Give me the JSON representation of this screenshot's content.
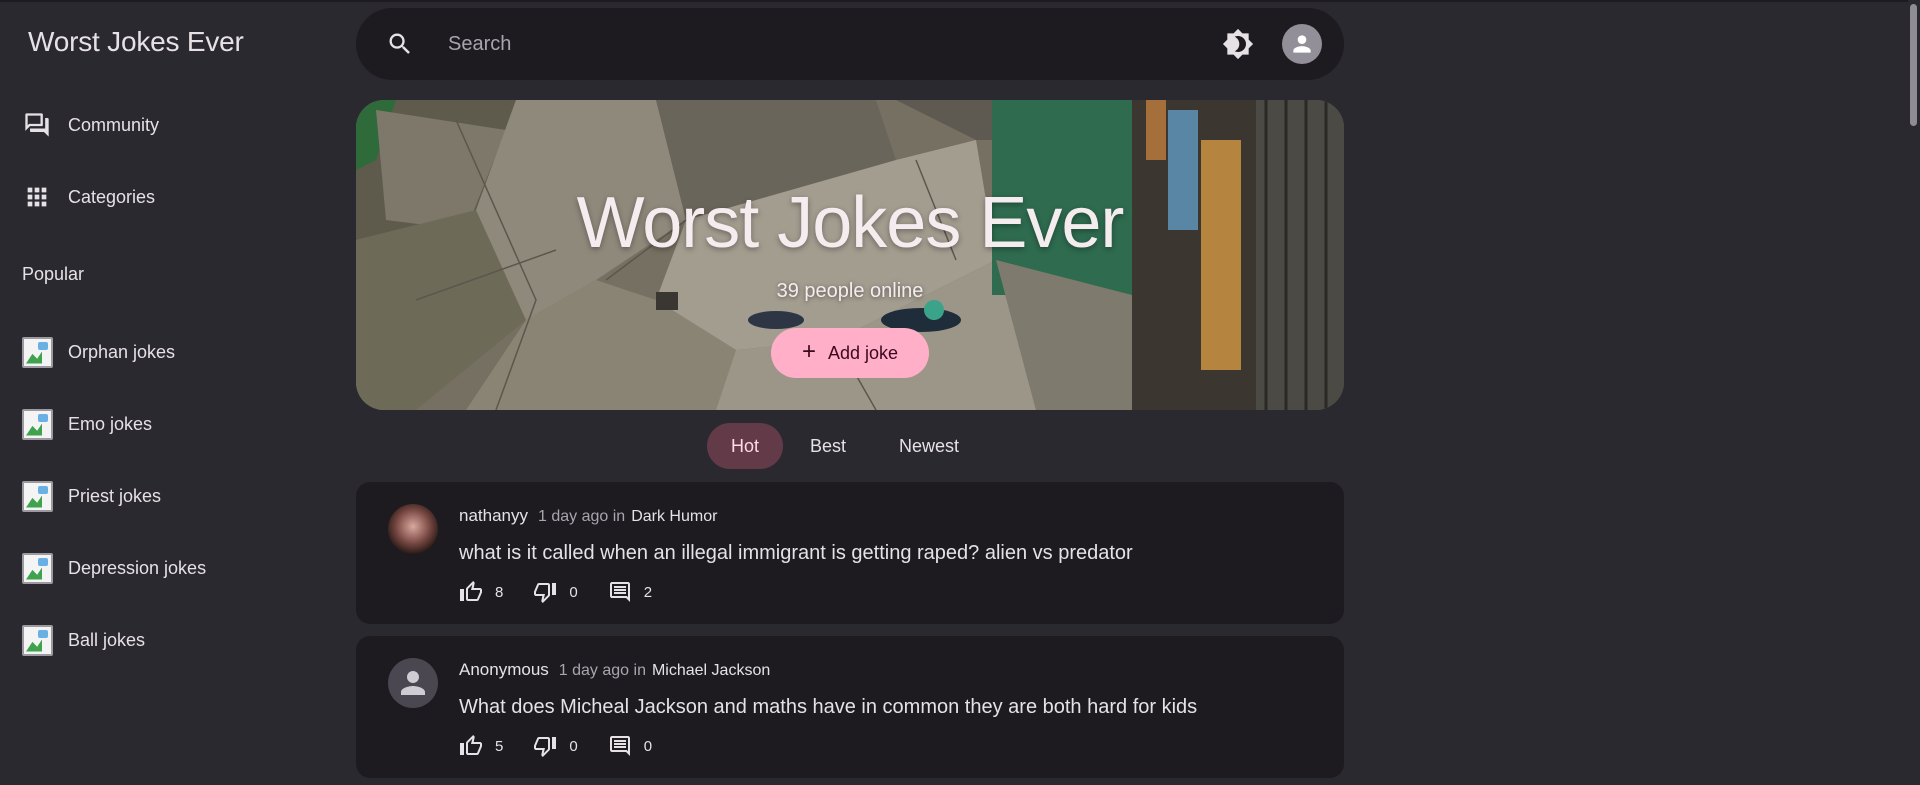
{
  "app": {
    "title": "Worst Jokes Ever"
  },
  "nav": [
    {
      "label": "Community",
      "icon": "forum-icon"
    },
    {
      "label": "Categories",
      "icon": "apps-grid-icon"
    }
  ],
  "popular": {
    "title": "Popular",
    "items": [
      {
        "label": "Orphan jokes"
      },
      {
        "label": "Emo jokes"
      },
      {
        "label": "Priest jokes"
      },
      {
        "label": "Depression jokes"
      },
      {
        "label": "Ball jokes"
      }
    ]
  },
  "search": {
    "placeholder": "Search",
    "value": ""
  },
  "hero": {
    "title": "Worst Jokes Ever",
    "subtitle": "39 people online",
    "add_label": "Add joke"
  },
  "tabs": [
    {
      "label": "Hot",
      "active": true
    },
    {
      "label": "Best",
      "active": false
    },
    {
      "label": "Newest",
      "active": false
    }
  ],
  "posts": [
    {
      "author": "nathanyy",
      "time": "1 day ago in",
      "category": "Dark Humor",
      "text": "what is it called when an illegal immigrant is getting raped? alien vs predator",
      "likes": "8",
      "dislikes": "0",
      "comments": "2"
    },
    {
      "author": "Anonymous",
      "time": "1 day ago in",
      "category": "Michael Jackson",
      "text": "What does Micheal Jackson and maths have in common they are both hard for kids",
      "likes": "5",
      "dislikes": "0",
      "comments": "0"
    }
  ],
  "colors": {
    "background": "#2b2930",
    "surface": "#1d1b20",
    "accent_button": "#ffb0c8",
    "active_tab": "#633b48"
  }
}
